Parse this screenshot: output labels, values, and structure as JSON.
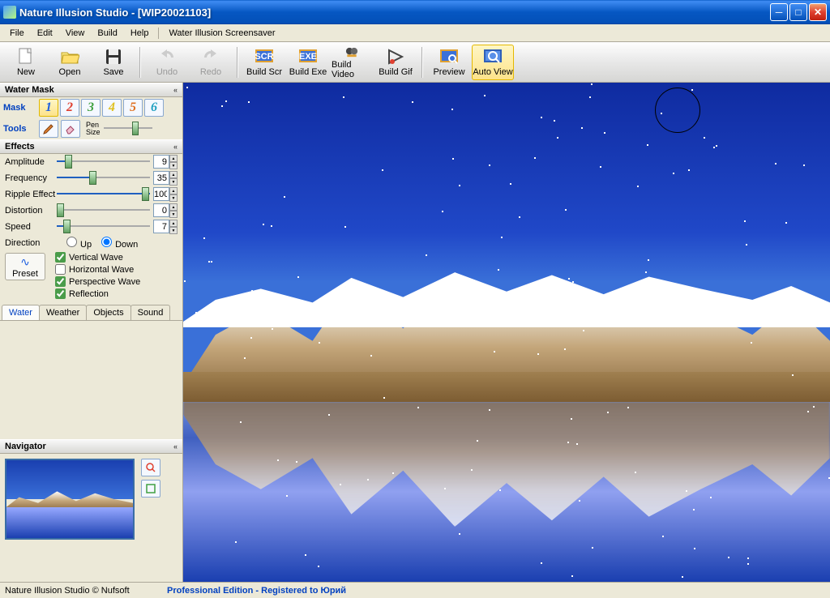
{
  "title": "Nature Illusion Studio - [WIP20021103]",
  "menu": {
    "file": "File",
    "edit": "Edit",
    "view": "View",
    "build": "Build",
    "help": "Help",
    "extra": "Water Illusion Screensaver"
  },
  "toolbar": {
    "new": "New",
    "open": "Open",
    "save": "Save",
    "undo": "Undo",
    "redo": "Redo",
    "buildscr": "Build Scr",
    "buildexe": "Build Exe",
    "buildvideo": "Build Video",
    "buildgif": "Build Gif",
    "preview": "Preview",
    "autoview": "Auto View"
  },
  "watermask": {
    "header": "Water Mask",
    "mask_lbl": "Mask",
    "tools_lbl": "Tools",
    "pen_label": "Pen\nSize"
  },
  "masknums": {
    "n1": "1",
    "n2": "2",
    "n3": "3",
    "n4": "4",
    "n5": "5",
    "n6": "6"
  },
  "effects": {
    "header": "Effects",
    "amplitude": {
      "label": "Amplitude",
      "value": "9"
    },
    "frequency": {
      "label": "Frequency",
      "value": "35"
    },
    "ripple": {
      "label": "Ripple Effect",
      "value": "100"
    },
    "distortion": {
      "label": "Distortion",
      "value": "0"
    },
    "speed": {
      "label": "Speed",
      "value": "7"
    },
    "direction": {
      "label": "Direction",
      "up": "Up",
      "down": "Down"
    },
    "vwave": "Vertical Wave",
    "hwave": "Horizontal Wave",
    "pwave": "Perspective Wave",
    "refl": "Reflection",
    "preset": "Preset"
  },
  "tabs": {
    "water": "Water",
    "weather": "Weather",
    "objects": "Objects",
    "sound": "Sound"
  },
  "navigator": {
    "header": "Navigator"
  },
  "status": {
    "left": "Nature Illusion Studio © Nufsoft",
    "right": "Professional Edition - Registered to Юрий"
  }
}
